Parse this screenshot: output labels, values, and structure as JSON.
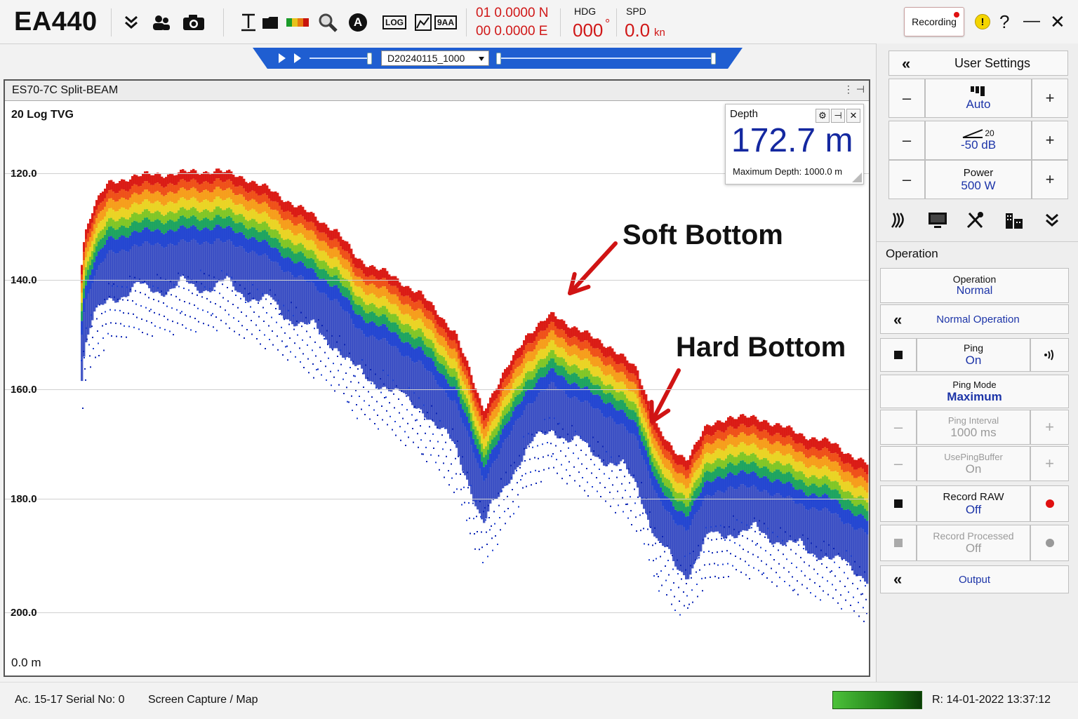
{
  "app": {
    "title": "EA440"
  },
  "toolbar": {
    "position": {
      "lat": "01 0.0000 N",
      "lon": "00 0.0000 E"
    },
    "heading": {
      "label": "HDG",
      "value": "000",
      "unit": "°"
    },
    "speed": {
      "label": "SPD",
      "value": "0.0",
      "unit": "kn"
    },
    "recording_label": "Recording",
    "log_label": "LOG",
    "aa_label": "9AA",
    "a_label": "A",
    "help_label": "?",
    "minimize_label": "—",
    "close_label": "✕"
  },
  "replay": {
    "file": "D20240115_1000"
  },
  "echogram": {
    "title": "ES70-7C Split-BEAM",
    "tvg": "20 Log TVG",
    "depth_labels": [
      "120.0",
      "140.0",
      "160.0",
      "180.0",
      "200.0"
    ],
    "range_label": "0.0 m",
    "annotations": {
      "soft": "Soft Bottom",
      "hard": "Hard Bottom"
    },
    "palette": [
      "#0a23b4",
      "#1b3fd0",
      "#15a05a",
      "#7cc41e",
      "#e9d21b",
      "#f59a12",
      "#ee4a10",
      "#d9120c"
    ]
  },
  "depth_widget": {
    "label": "Depth",
    "value": "172.7 m",
    "max": "Maximum Depth: 1000.0 m"
  },
  "user_settings": {
    "title": "User Settings",
    "rows": [
      {
        "value": "Auto"
      },
      {
        "small": "20",
        "value": "-50 dB"
      },
      {
        "label": "Power",
        "value": "500 W"
      }
    ],
    "minus": "–",
    "plus": "+"
  },
  "operation": {
    "section": "Operation",
    "items": [
      {
        "label": "Operation",
        "value": "Normal"
      },
      {
        "label": "Normal Operation"
      },
      {
        "label": "Ping",
        "value": "On"
      },
      {
        "label": "Ping Mode",
        "value": "Maximum"
      },
      {
        "label": "Ping Interval",
        "value": "1000 ms"
      },
      {
        "label": "UsePingBuffer",
        "value": "On"
      },
      {
        "label": "Record RAW",
        "value": "Off"
      },
      {
        "label": "Record Processed",
        "value": "Off"
      },
      {
        "label": "Output"
      }
    ]
  },
  "status": {
    "device": "Ac. 15-17 Serial No: 0",
    "mode": "Screen Capture / Map",
    "datetime": "R: 14-01-2022  13:37:12"
  }
}
